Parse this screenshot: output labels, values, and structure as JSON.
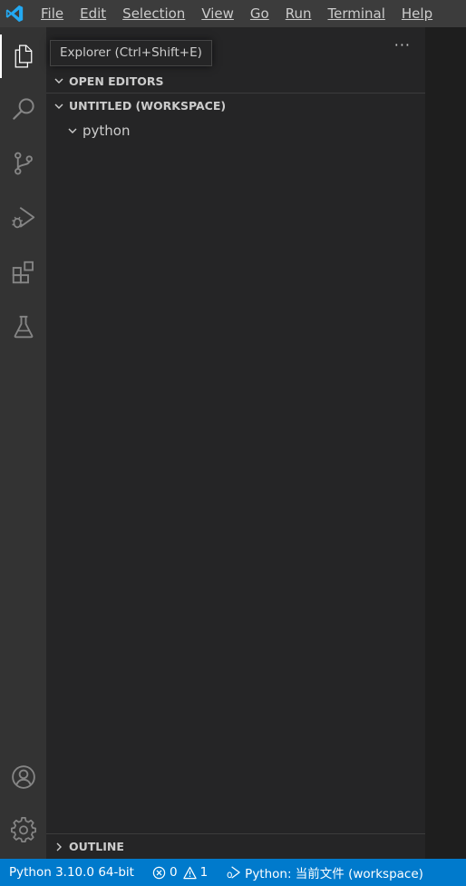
{
  "menubar": {
    "items": [
      "File",
      "Edit",
      "Selection",
      "View",
      "Go",
      "Run",
      "Terminal",
      "Help"
    ]
  },
  "activitybar": {
    "active": "Explorer",
    "items": [
      "explorer",
      "search",
      "source-control",
      "run-and-debug",
      "extensions",
      "testing"
    ],
    "bottom": [
      "accounts",
      "manage"
    ]
  },
  "tooltip": {
    "text": "Explorer (Ctrl+Shift+E)"
  },
  "sidebar": {
    "sections": [
      {
        "title": "OPEN EDITORS",
        "expanded": true
      },
      {
        "title": "UNTITLED (WORKSPACE)",
        "expanded": true
      },
      {
        "title": "OUTLINE",
        "expanded": false
      }
    ],
    "tree": [
      {
        "label": "python",
        "expanded": true
      }
    ]
  },
  "statusbar": {
    "interpreter": "Python 3.10.0 64-bit",
    "errors": "0",
    "warnings": "1",
    "run_config": "Python: 当前文件 (workspace)"
  },
  "colors": {
    "titlebar": "#3c3c3c",
    "activitybar": "#333333",
    "sidebar": "#252526",
    "editor": "#1e1e1e",
    "statusbar": "#007acc",
    "logo": "#23a9f2"
  }
}
